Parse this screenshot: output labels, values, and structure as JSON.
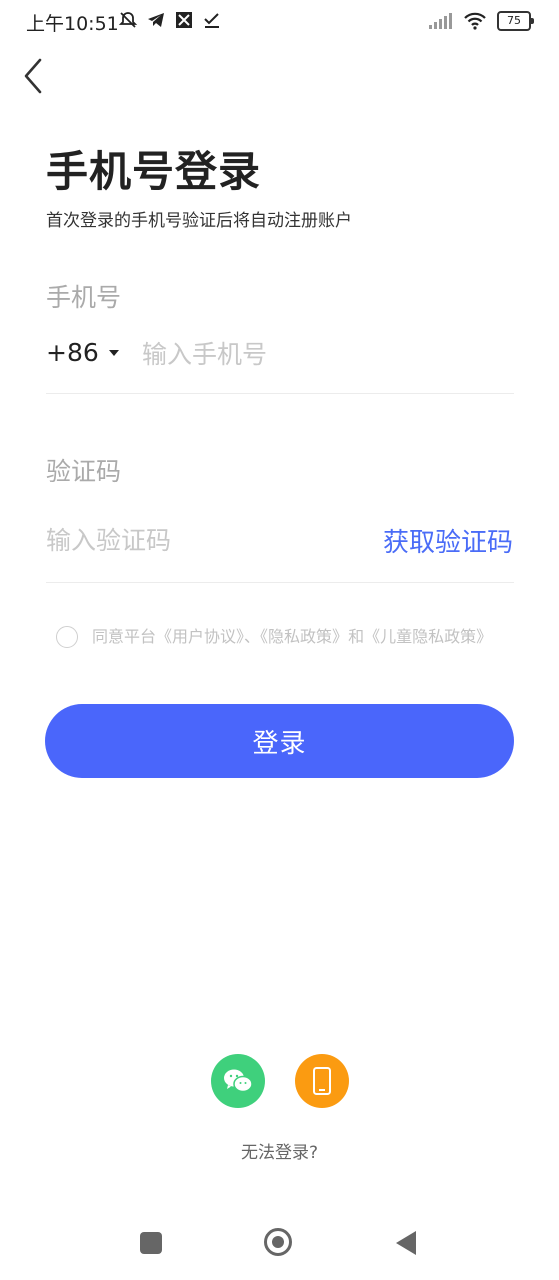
{
  "status_bar": {
    "time": "上午10:51",
    "battery": "75",
    "icons": [
      "mute-icon",
      "telegram-icon",
      "app-icon",
      "check-icon",
      "signal-icon",
      "wifi-icon"
    ]
  },
  "header": {
    "back_icon": "chevron-left-icon",
    "title": "手机号登录",
    "subtitle": "首次登录的手机号验证后将自动注册账户"
  },
  "phone": {
    "label": "手机号",
    "country_code": "+86",
    "placeholder": "输入手机号"
  },
  "code": {
    "label": "验证码",
    "placeholder": "输入验证码",
    "get_code": "获取验证码"
  },
  "agreement": {
    "prefix": "同意平台",
    "user_agreement": "《用户协议》",
    "sep1": "、",
    "privacy_policy": "《隐私政策》",
    "and": "和",
    "child_privacy": "《儿童隐私政策》"
  },
  "login_button": "登录",
  "alt_login": {
    "wechat_icon": "wechat-icon",
    "phone_icon": "mobile-phone-icon"
  },
  "cant_login": "无法登录?",
  "colors": {
    "accent": "#4a66fb",
    "link": "#4a6cf7",
    "wechat": "#3fd07c",
    "phone": "#fb9b11"
  }
}
